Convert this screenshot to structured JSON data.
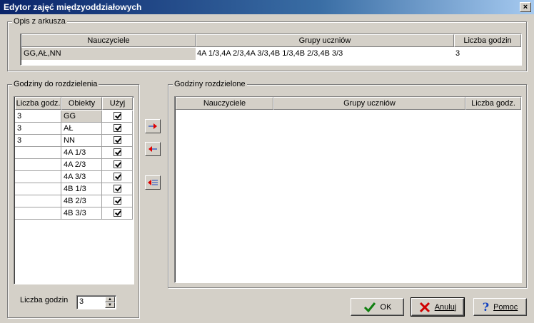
{
  "window": {
    "title": "Edytor zajęć międzyoddziałowych",
    "close": "×"
  },
  "opis": {
    "legend": "Opis z arkusza",
    "headers": [
      "Nauczyciele",
      "Grupy uczniów",
      "Liczba godzin"
    ],
    "row": {
      "nauczyciele": "GG,AŁ,NN",
      "grupy": "4A 1/3,4A 2/3,4A 3/3,4B 1/3,4B 2/3,4B 3/3",
      "liczba": "3"
    }
  },
  "do_rozdzielenia": {
    "legend": "Godziny do rozdzielenia",
    "headers": [
      "Liczba godz.",
      "Obiekty",
      "Użyj"
    ],
    "rows": [
      {
        "liczba": "3",
        "obiekt": "GG",
        "uzyj": true
      },
      {
        "liczba": "3",
        "obiekt": "AŁ",
        "uzyj": true
      },
      {
        "liczba": "3",
        "obiekt": "NN",
        "uzyj": true
      },
      {
        "liczba": "",
        "obiekt": "4A 1/3",
        "uzyj": true
      },
      {
        "liczba": "",
        "obiekt": "4A 2/3",
        "uzyj": true
      },
      {
        "liczba": "",
        "obiekt": "4A 3/3",
        "uzyj": true
      },
      {
        "liczba": "",
        "obiekt": "4B 1/3",
        "uzyj": true
      },
      {
        "liczba": "",
        "obiekt": "4B 2/3",
        "uzyj": true
      },
      {
        "liczba": "",
        "obiekt": "4B 3/3",
        "uzyj": true
      }
    ],
    "liczba_godzin_label": "Liczba godzin",
    "liczba_godzin_value": "3"
  },
  "rozdzielone": {
    "legend": "Godziny rozdzielone",
    "headers": [
      "Nauczyciele",
      "Grupy uczniów",
      "Liczba godz."
    ]
  },
  "buttons": {
    "ok": "OK",
    "anuluj": "Anuluj",
    "pomoc": "Pomoc"
  },
  "colors": {
    "face": "#d4d0c8",
    "title": "#0a246a",
    "selected_cell": "#d4d0c8"
  }
}
